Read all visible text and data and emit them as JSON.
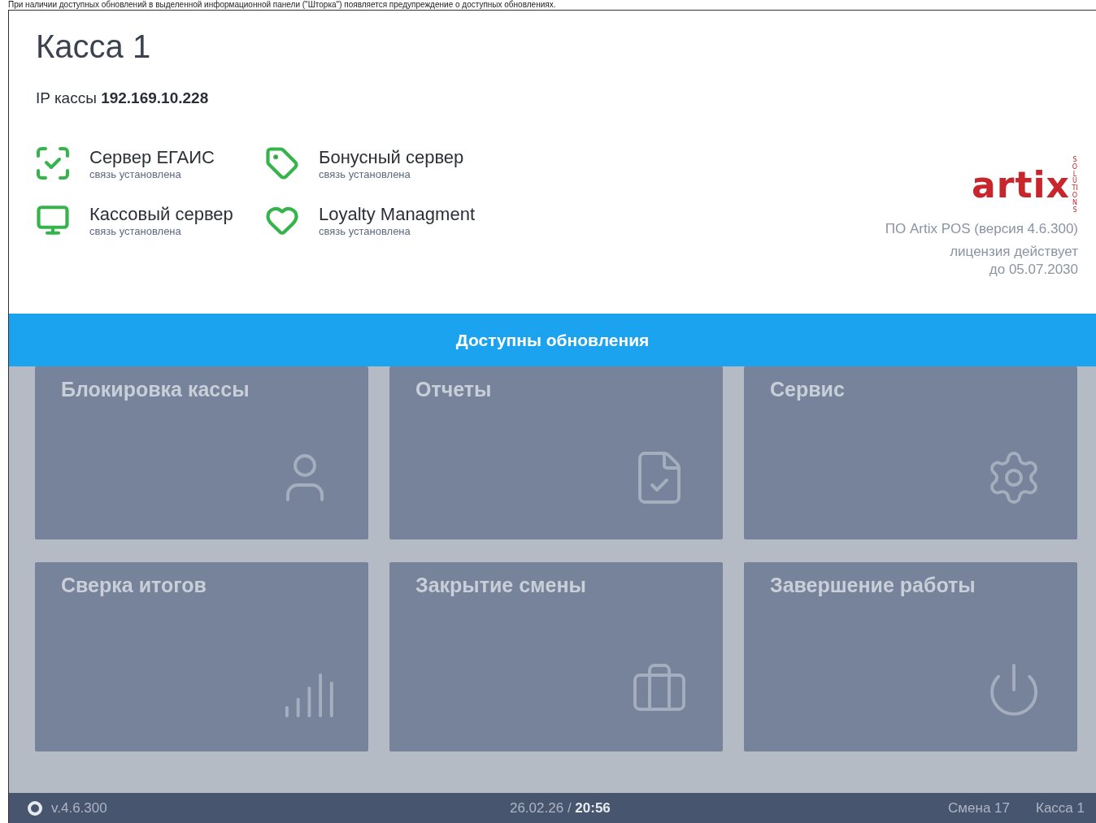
{
  "caption": "При наличии доступных обновлений в выделенной информационной панели (\"Шторка\") появляется предупреждение о доступных обновлениях.",
  "title": "Касса 1",
  "ip": {
    "label": "IP кассы",
    "value": "192.169.10.228"
  },
  "services": [
    {
      "kind": "scan",
      "name": "Сервер ЕГАИС",
      "status": "связь установлена"
    },
    {
      "kind": "tag",
      "name": "Бонусный сервер",
      "status": "связь установлена"
    },
    {
      "kind": "monitor",
      "name": "Кассовый сервер",
      "status": "связь установлена"
    },
    {
      "kind": "heart",
      "name": "Loyalty Managment",
      "status": "связь установлена"
    }
  ],
  "logo": {
    "text": "artix",
    "tagline": "SOLUTIONS"
  },
  "product": "ПО Artix POS (версия 4.6.300)",
  "license": [
    "лицензия действует",
    "до 05.07.2030"
  ],
  "banner": "Доступны обновления",
  "tiles": [
    {
      "kind": "user",
      "label": "Блокировка кассы",
      "disabled": true
    },
    {
      "kind": "report",
      "label": "Отчеты",
      "disabled": true
    },
    {
      "kind": "gear",
      "label": "Сервис",
      "disabled": true
    },
    {
      "kind": "bars",
      "label": "Сверка итогов",
      "disabled": true
    },
    {
      "kind": "briefcase",
      "label": "Закрытие смены",
      "disabled": true
    },
    {
      "kind": "power",
      "label": "Завершение работы",
      "disabled": true
    }
  ],
  "footer": {
    "version": "v.4.6.300",
    "date": "26.02.26",
    "separator": "/",
    "time": "20:56",
    "shift": "Смена 17",
    "register": "Касса 1"
  }
}
